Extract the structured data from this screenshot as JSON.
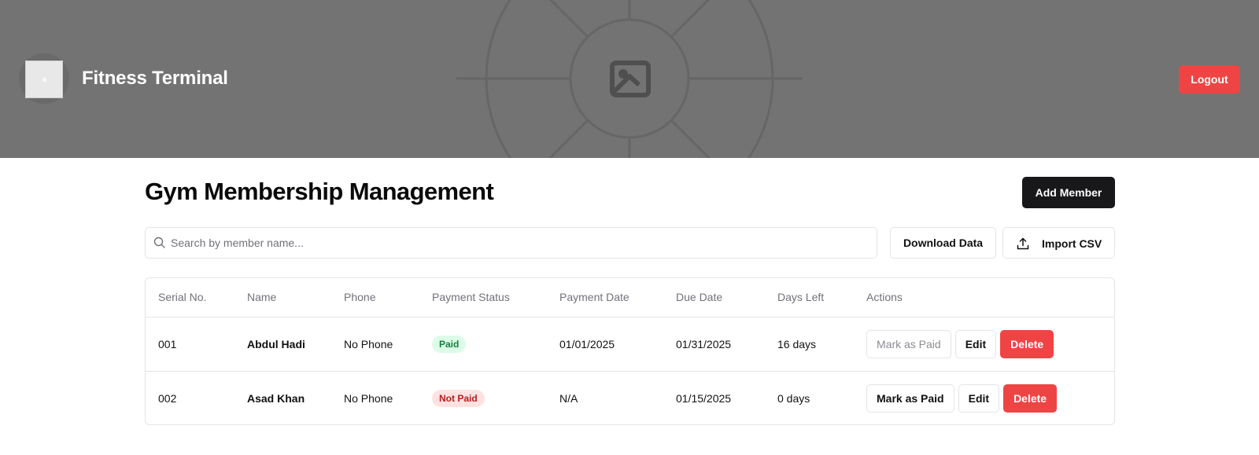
{
  "header": {
    "app_title": "Fitness Terminal",
    "logout_label": "Logout",
    "banner_icon": "image-placeholder-icon"
  },
  "main": {
    "page_title": "Gym Membership Management",
    "add_member_label": "Add Member",
    "search": {
      "placeholder": "Search by member name...",
      "value": ""
    },
    "download_label": "Download Data",
    "import_label": "Import CSV"
  },
  "table": {
    "columns": [
      "Serial No.",
      "Name",
      "Phone",
      "Payment Status",
      "Payment Date",
      "Due Date",
      "Days Left",
      "Actions"
    ],
    "rows": [
      {
        "serial": "001",
        "name": "Abdul Hadi",
        "phone": "No Phone",
        "status": "Paid",
        "payment_date": "01/01/2025",
        "due_date": "01/31/2025",
        "days_left": "16 days",
        "actions": {
          "mark": "Mark as Paid",
          "edit": "Edit",
          "delete": "Delete"
        }
      },
      {
        "serial": "002",
        "name": "Asad Khan",
        "phone": "No Phone",
        "status": "Not Paid",
        "payment_date": "N/A",
        "due_date": "01/15/2025",
        "days_left": "0 days",
        "actions": {
          "mark": "Mark as Paid",
          "edit": "Edit",
          "delete": "Delete"
        }
      }
    ]
  },
  "colors": {
    "banner": "#737373",
    "danger": "#ef4444",
    "primary": "#18181b",
    "paid_bg": "#dcfce7",
    "paid_text": "#15803d",
    "unpaid_bg": "#fee2e2",
    "unpaid_text": "#b91c1c"
  }
}
